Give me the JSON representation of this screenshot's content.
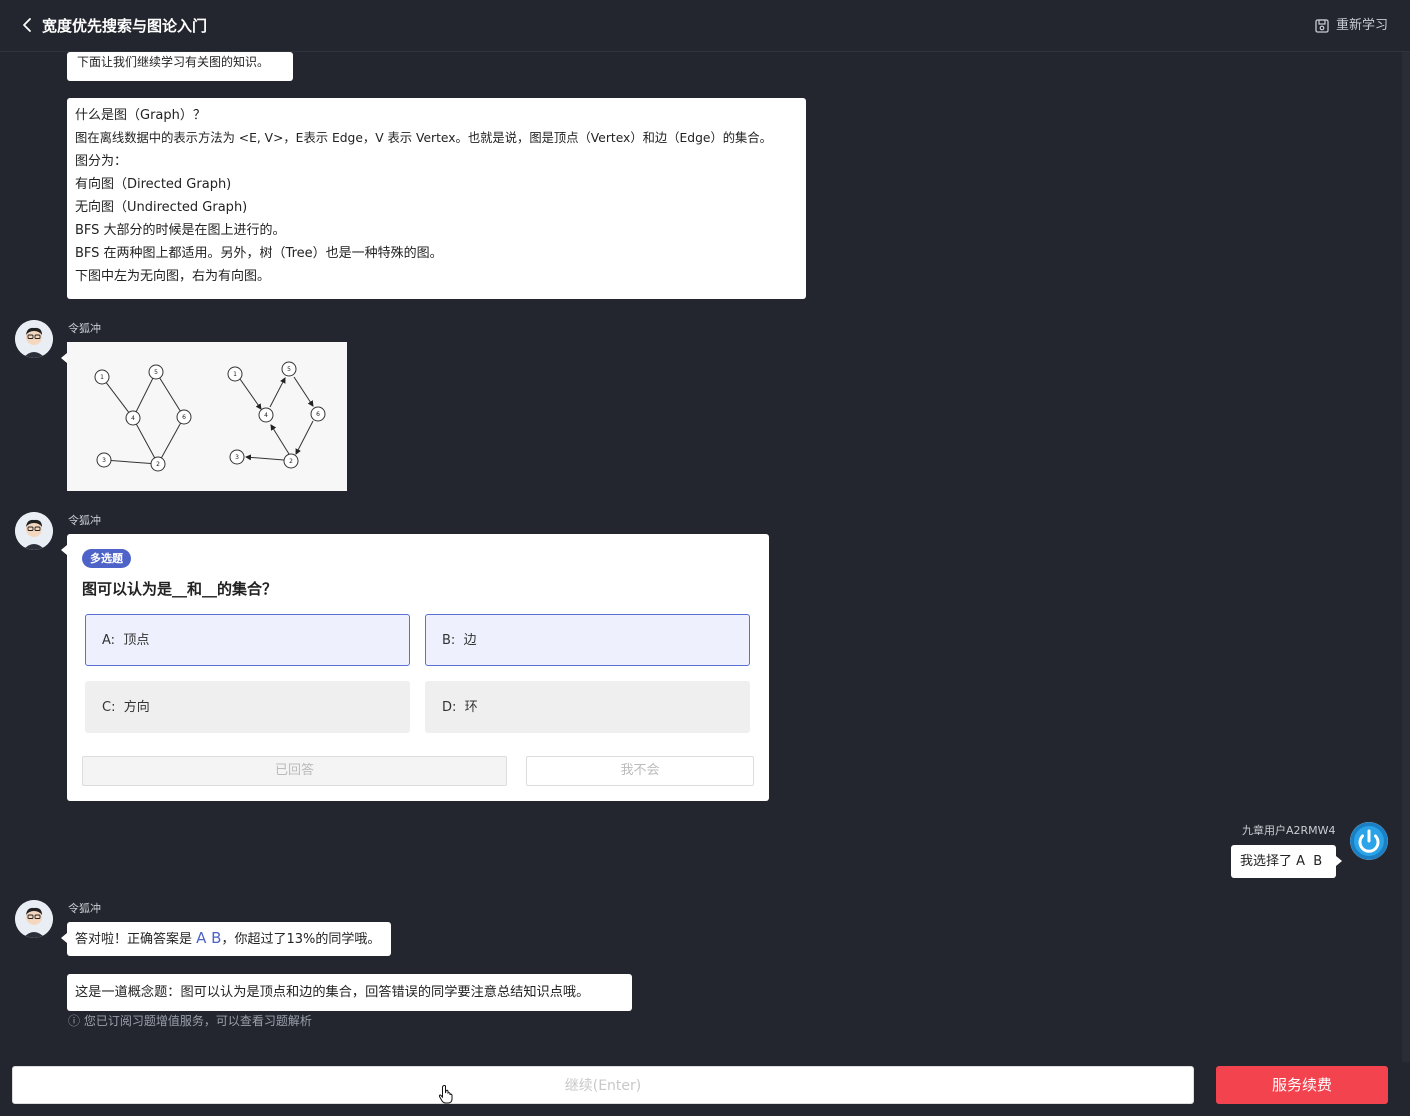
{
  "header": {
    "title": "宽度优先搜索与图论入门",
    "restart_label": "重新学习"
  },
  "messages": {
    "top_partial": "下面让我们继续学习有关图的知识。",
    "graph_intro_lines": [
      "什么是图（Graph）？",
      "图在离线数据中的表示方法为 <E, V>，E表示 Edge，V 表示 Vertex。也就是说，图是顶点（Vertex）和边（Edge）的集合。",
      "图分为：",
      "有向图（Directed Graph)",
      "无向图（Undirected Graph)",
      "BFS 大部分的时候是在图上进行的。",
      "BFS 在两种图上都适用。另外，树（Tree）也是一种特殊的图。",
      "下图中左为无向图，右为有向图。"
    ],
    "teacher_name": "令狐冲",
    "graph_nodes": {
      "undirected": [
        "1",
        "5",
        "4",
        "6",
        "3",
        "2"
      ],
      "directed": [
        "1",
        "5",
        "4",
        "6",
        "3",
        "2"
      ]
    }
  },
  "quiz": {
    "tag": "多选题",
    "question": "图可以认为是__和__的集合？",
    "options": [
      {
        "key": "A:",
        "text": "顶点",
        "selected": true
      },
      {
        "key": "B:",
        "text": "边",
        "selected": true
      },
      {
        "key": "C:",
        "text": "方向",
        "selected": false
      },
      {
        "key": "D:",
        "text": "环",
        "selected": false
      }
    ],
    "answered_label": "已回答",
    "dont_know_label": "我不会"
  },
  "user": {
    "name": "九章用户A2RMW4",
    "reply": "我选择了 A  B"
  },
  "feedback": {
    "prefix": "答对啦！正确答案是",
    "answer": "A B",
    "suffix": "，你超过了13%的同学哦。",
    "explanation": "这是一道概念题：图可以认为是顶点和边的集合，回答错误的同学要注意总结知识点哦。",
    "hint": "ⓘ 您已订阅习题增值服务，可以查看习题解析"
  },
  "footer": {
    "continue_label": "继续(Enter)",
    "renew_label": "服务续费"
  },
  "colors": {
    "background": "#23262e",
    "accent": "#4e63c8",
    "danger": "#f2434f"
  }
}
